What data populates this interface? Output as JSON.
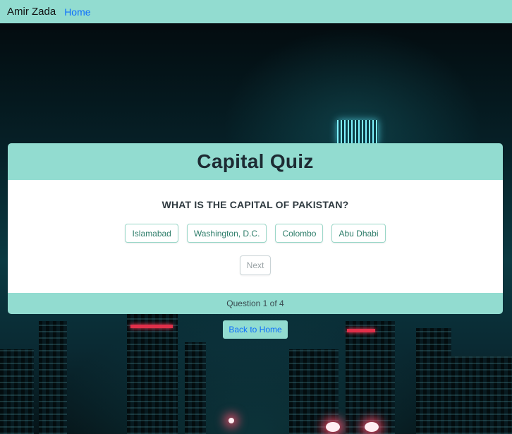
{
  "navbar": {
    "brand": "Amir Zada",
    "home_link": "Home"
  },
  "quiz": {
    "title": "Capital Quiz",
    "question": "WHAT IS THE CAPITAL OF PAKISTAN?",
    "options": [
      "Islamabad",
      "Washington, D.C.",
      "Colombo",
      "Abu Dhabi"
    ],
    "next_label": "Next",
    "progress": "Question 1 of 4"
  },
  "back_home_label": "Back to Home",
  "colors": {
    "navbar_bg": "#92dcd0",
    "link": "#0d6efd",
    "option_border": "#9ad7c8"
  }
}
